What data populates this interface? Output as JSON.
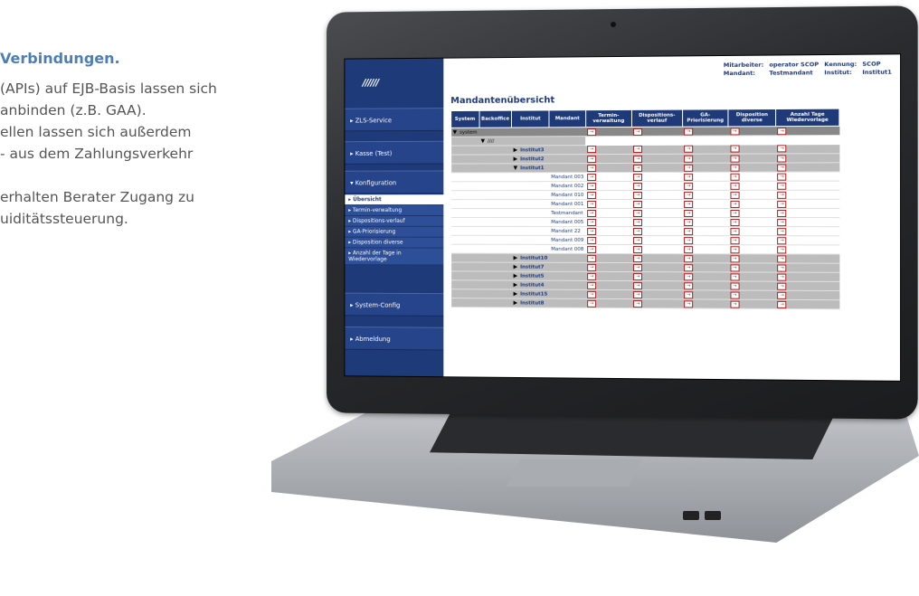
{
  "textcol": {
    "heading": "Verbindungen.",
    "lines": [
      "(APIs) auf EJB-Basis lassen sich",
      "anbinden (z.B. GAA).",
      "ellen  lassen  sich  außerdem",
      "-  aus  dem  Zahlungsverkehr",
      "",
      "erhalten  Berater  Zugang  zu",
      "uiditätssteuerung."
    ]
  },
  "app": {
    "top_info": {
      "mitarbeiter_label": "Mitarbeiter:",
      "mitarbeiter_value": "operator SCOP",
      "kennung_label": "Kennung:",
      "kennung_value": "SCOP",
      "mandant_label": "Mandant:",
      "mandant_value": "Testmandant",
      "institut_label": "Institut:",
      "institut_value": "Institut1"
    },
    "title": "Mandantenübersicht",
    "sidebar": {
      "items": [
        {
          "label": "ZLS-Service"
        },
        {
          "label": "Kasse (Test)"
        },
        {
          "label": "Konfiguration"
        }
      ],
      "subitems": [
        {
          "label": "Übersicht"
        },
        {
          "label": "Termin-verwaltung"
        },
        {
          "label": "Dispositions-verlauf"
        },
        {
          "label": "GA-Priorisierung"
        },
        {
          "label": "Disposition diverse"
        },
        {
          "label": "Anzahl der Tage in Wiedervorlage"
        }
      ],
      "bottom_items": [
        {
          "label": "System-Config"
        },
        {
          "label": "Abmeldung"
        }
      ]
    },
    "table": {
      "headers": [
        "System",
        "Backoffice",
        "Institut",
        "Mandant",
        "Termin-verwaltung",
        "Dispositions-verlauf",
        "GA-Priorisierung",
        "Disposition diverse",
        "Anzahl Tage Wiedervorlage"
      ],
      "system_row": "system",
      "institutes_top": [
        "Institut3",
        "Institut2",
        "Institut1"
      ],
      "mandanten": [
        "Mandant 003",
        "Mandant 002",
        "Mandant 010",
        "Mandant 001",
        "Testmandant",
        "Mandant 005",
        "Mandant 22",
        "Mandant 009",
        "Mandant 008"
      ],
      "institutes_bottom": [
        "Institut10",
        "Institut7",
        "Institut5",
        "Institut4",
        "Institut15",
        "Institut8"
      ]
    }
  }
}
